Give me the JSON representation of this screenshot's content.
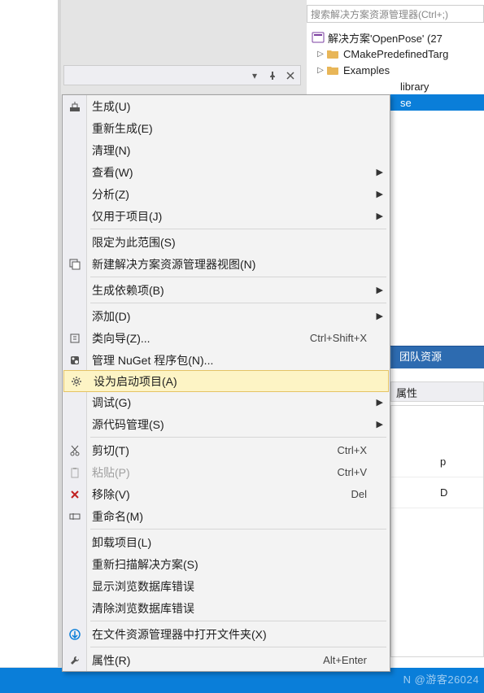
{
  "search": {
    "placeholder": "搜索解决方案资源管理器(Ctrl+;)"
  },
  "solution": {
    "root": "解决方案'OpenPose' (27 ",
    "items": [
      {
        "label": "CMakePredefinedTarg",
        "sel": false
      },
      {
        "label": "Examples",
        "sel": false
      },
      {
        "label": "library",
        "sel": false,
        "partial": true
      },
      {
        "label": "se",
        "sel": true
      }
    ]
  },
  "tabs": {
    "team_explorer": "团队资源"
  },
  "properties": {
    "header": "属性",
    "rows": [
      "p",
      "D"
    ]
  },
  "watermark": "N @游客26024",
  "toolbar": {
    "dropdown": "▾",
    "pin": "⊓",
    "close": "✕"
  },
  "context_menu": {
    "items": [
      {
        "label": "生成(U)",
        "icon": "build"
      },
      {
        "label": "重新生成(E)"
      },
      {
        "label": "清理(N)"
      },
      {
        "label": "查看(W)",
        "submenu": true
      },
      {
        "label": "分析(Z)",
        "submenu": true
      },
      {
        "label": "仅用于项目(J)",
        "submenu": true
      },
      {
        "sep": true
      },
      {
        "label": "限定为此范围(S)"
      },
      {
        "label": "新建解决方案资源管理器视图(N)",
        "icon": "newview"
      },
      {
        "sep": true
      },
      {
        "label": "生成依赖项(B)",
        "submenu": true
      },
      {
        "sep": true
      },
      {
        "label": "添加(D)",
        "submenu": true
      },
      {
        "label": "类向导(Z)...",
        "shortcut": "Ctrl+Shift+X",
        "icon": "class"
      },
      {
        "label": "管理 NuGet 程序包(N)...",
        "icon": "nuget"
      },
      {
        "label": "设为启动项目(A)",
        "highlight": true,
        "icon": "gear"
      },
      {
        "label": "调试(G)",
        "submenu": true
      },
      {
        "label": "源代码管理(S)",
        "submenu": true
      },
      {
        "sep": true
      },
      {
        "label": "剪切(T)",
        "shortcut": "Ctrl+X",
        "icon": "cut"
      },
      {
        "label": "粘贴(P)",
        "shortcut": "Ctrl+V",
        "disabled": true,
        "icon": "paste"
      },
      {
        "label": "移除(V)",
        "shortcut": "Del",
        "icon": "remove"
      },
      {
        "label": "重命名(M)",
        "icon": "rename"
      },
      {
        "sep": true
      },
      {
        "label": "卸载项目(L)"
      },
      {
        "label": "重新扫描解决方案(S)"
      },
      {
        "label": "显示浏览数据库错误"
      },
      {
        "label": "清除浏览数据库错误"
      },
      {
        "sep": true
      },
      {
        "label": "在文件资源管理器中打开文件夹(X)",
        "icon": "open"
      },
      {
        "sep": true
      },
      {
        "label": "属性(R)",
        "shortcut": "Alt+Enter",
        "icon": "wrench"
      }
    ]
  }
}
